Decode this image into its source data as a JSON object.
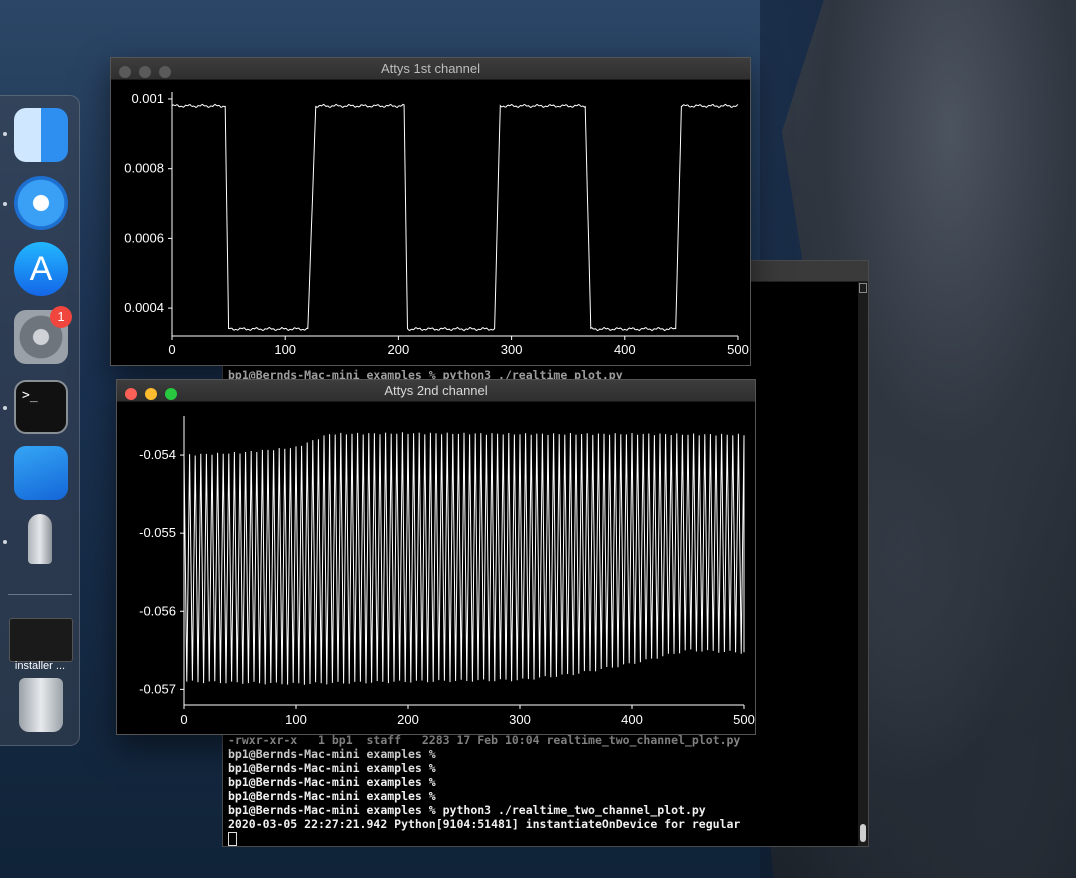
{
  "dock": {
    "items": [
      {
        "name": "Finder"
      },
      {
        "name": "Safari"
      },
      {
        "name": "App Store"
      },
      {
        "name": "System Preferences",
        "badge": "1"
      },
      {
        "name": "Terminal",
        "icon_text": ">_"
      },
      {
        "name": "Xcode"
      },
      {
        "name": "Python Launcher"
      }
    ],
    "installer_label": "installer ...",
    "trash": "Trash"
  },
  "terminal": {
    "line_top": "bp1@Bernds-Mac-mini examples % python3 ./realtime_plot.py",
    "line_partial": "-rwxr-xr-x   1 bp1  staff   2283 17 Feb 10:04 realtime_two_channel_plot.py",
    "lines": [
      "bp1@Bernds-Mac-mini examples %",
      "bp1@Bernds-Mac-mini examples %",
      "bp1@Bernds-Mac-mini examples %",
      "bp1@Bernds-Mac-mini examples %",
      "bp1@Bernds-Mac-mini examples % python3 ./realtime_two_channel_plot.py",
      "2020-03-05 22:27:21.942 Python[9104:51481] instantiateOnDevice for regular"
    ]
  },
  "window1": {
    "title": "Attys 1st channel",
    "chart_data": {
      "type": "line",
      "x_ticks": [
        "0",
        "100",
        "200",
        "300",
        "400",
        "500"
      ],
      "y_ticks": [
        "0.0004",
        "0.0006",
        "0.0008",
        "0.001"
      ],
      "xlim": [
        0,
        500
      ],
      "ylim": [
        0.00032,
        0.00102
      ],
      "grid": false,
      "series": [
        {
          "x": [
            0,
            47,
            50,
            120,
            127,
            205,
            208,
            285,
            290,
            365,
            370,
            445,
            450,
            500
          ],
          "y": [
            0.00098,
            0.00098,
            0.00034,
            0.00034,
            0.00098,
            0.00098,
            0.00034,
            0.00034,
            0.00098,
            0.00098,
            0.00034,
            0.00034,
            0.00098,
            0.00098
          ]
        }
      ]
    }
  },
  "window2": {
    "title": "Attys 2nd channel",
    "chart_data": {
      "type": "line",
      "x_ticks": [
        "0",
        "100",
        "200",
        "300",
        "400",
        "500"
      ],
      "y_ticks": [
        "-0.054",
        "-0.055",
        "-0.056",
        "-0.057"
      ],
      "xlim": [
        0,
        500
      ],
      "ylim": [
        -0.0572,
        -0.0535
      ],
      "grid": false,
      "oscillation_count": 100,
      "series": [
        {
          "name": "upper envelope",
          "x": [
            0,
            50,
            100,
            130,
            200,
            300,
            400,
            500
          ],
          "y": [
            -0.054,
            -0.05397,
            -0.0539,
            -0.05373,
            -0.05372,
            -0.05373,
            -0.05373,
            -0.05374
          ]
        },
        {
          "name": "lower envelope",
          "x": [
            0,
            100,
            200,
            300,
            350,
            400,
            450,
            500
          ],
          "y": [
            -0.0569,
            -0.05693,
            -0.0569,
            -0.05688,
            -0.0568,
            -0.05667,
            -0.0565,
            -0.05653
          ]
        }
      ]
    }
  }
}
